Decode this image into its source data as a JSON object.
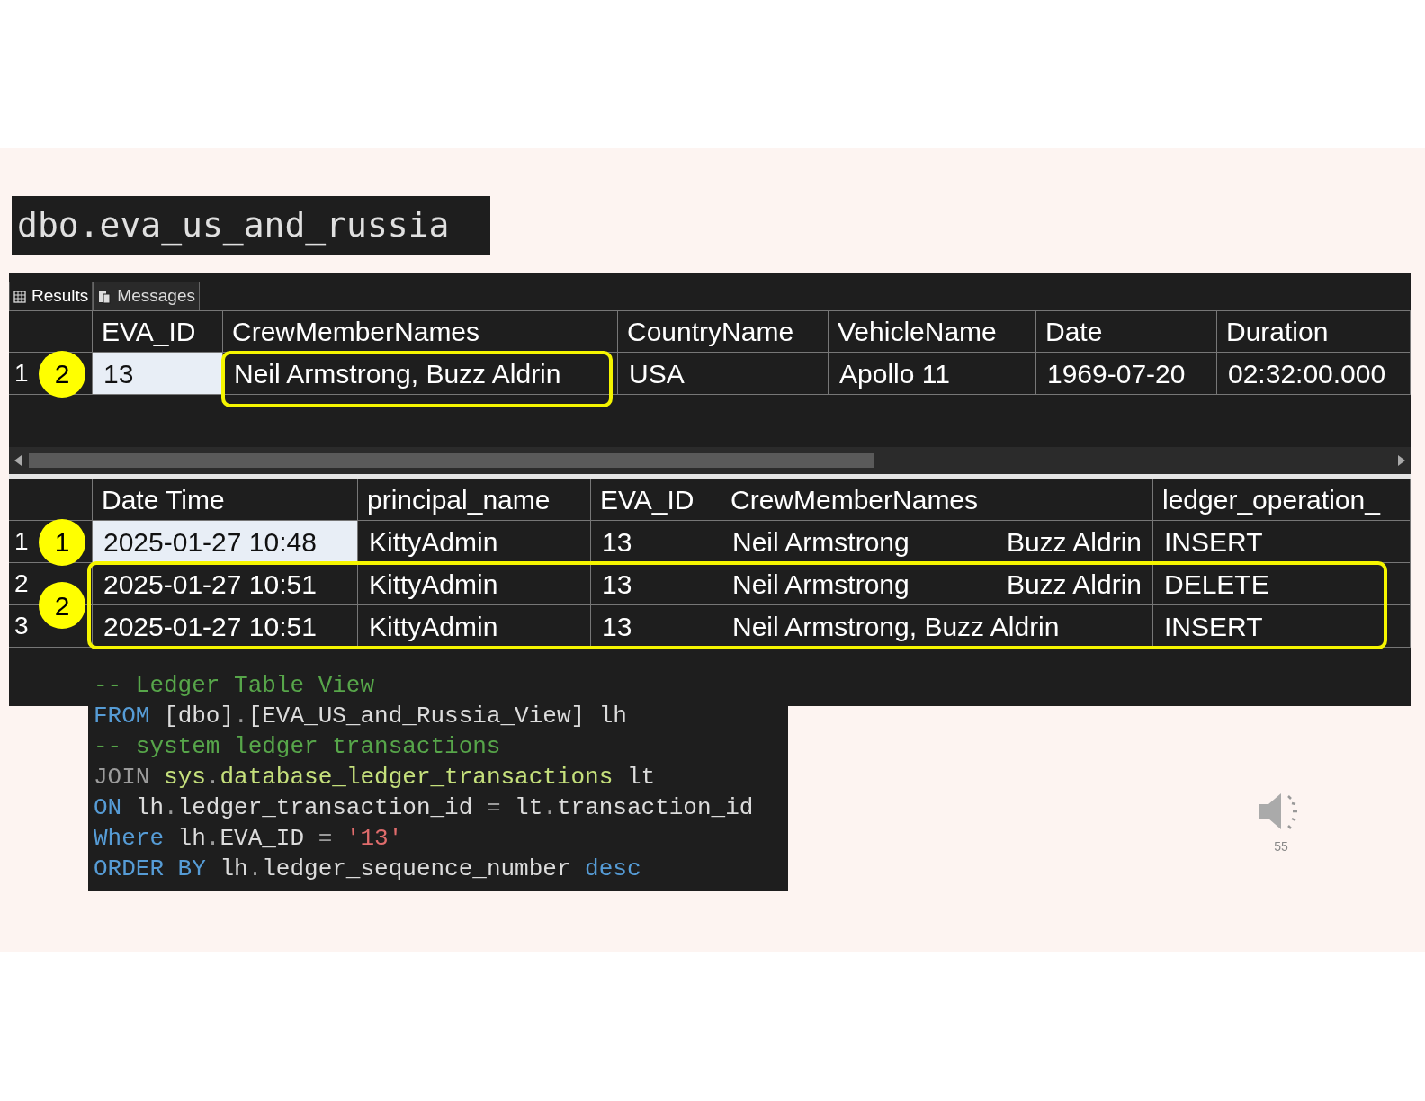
{
  "title": "dbo.eva_us_and_russia",
  "tabs": [
    {
      "label": "Results",
      "selected": true
    },
    {
      "label": "Messages",
      "selected": false
    }
  ],
  "results_table": {
    "columns": [
      "EVA_ID",
      "CrewMemberNames",
      "CountryName",
      "VehicleName",
      "Date",
      "Duration"
    ],
    "row_groups": [
      {
        "badge": "2",
        "outlined": false,
        "rows": [
          {
            "number": "1",
            "cells": [
              {
                "text": [
                  "13"
                ],
                "selected": true,
                "outlined": false
              },
              {
                "text": [
                  "Neil Armstrong, Buzz Aldrin"
                ],
                "selected": false,
                "outlined": true
              },
              {
                "text": [
                  "USA"
                ],
                "selected": false,
                "outlined": false
              },
              {
                "text": [
                  "Apollo 11"
                ],
                "selected": false,
                "outlined": false
              },
              {
                "text": [
                  "1969-07-20"
                ],
                "selected": false,
                "outlined": false
              },
              {
                "text": [
                  "02:32:00.000"
                ],
                "selected": false,
                "outlined": false
              }
            ]
          }
        ]
      }
    ]
  },
  "ledger_table": {
    "columns": [
      "Date Time",
      "principal_name",
      "EVA_ID",
      "CrewMemberNames",
      "ledger_operation_"
    ],
    "row_groups": [
      {
        "badge": "1",
        "outlined": false,
        "rows": [
          {
            "number": "1",
            "cells": [
              {
                "text": [
                  "2025-01-27 10:48"
                ],
                "selected": true,
                "outlined": false
              },
              {
                "text": [
                  "KittyAdmin"
                ],
                "selected": false,
                "outlined": false
              },
              {
                "text": [
                  "13"
                ],
                "selected": false,
                "outlined": false
              },
              {
                "text": [
                  "Neil Armstrong",
                  "Buzz Aldrin"
                ],
                "selected": false,
                "outlined": false
              },
              {
                "text": [
                  "INSERT"
                ],
                "selected": false,
                "outlined": false
              }
            ]
          }
        ]
      },
      {
        "badge": "2",
        "outlined": true,
        "rows": [
          {
            "number": "2",
            "cells": [
              {
                "text": [
                  "2025-01-27 10:51"
                ],
                "selected": false,
                "outlined": false
              },
              {
                "text": [
                  "KittyAdmin"
                ],
                "selected": false,
                "outlined": false
              },
              {
                "text": [
                  "13"
                ],
                "selected": false,
                "outlined": false
              },
              {
                "text": [
                  "Neil Armstrong",
                  "Buzz Aldrin"
                ],
                "selected": false,
                "outlined": false
              },
              {
                "text": [
                  "DELETE"
                ],
                "selected": false,
                "outlined": false
              }
            ]
          },
          {
            "number": "3",
            "cells": [
              {
                "text": [
                  "2025-01-27 10:51"
                ],
                "selected": false,
                "outlined": false
              },
              {
                "text": [
                  "KittyAdmin"
                ],
                "selected": false,
                "outlined": false
              },
              {
                "text": [
                  "13"
                ],
                "selected": false,
                "outlined": false
              },
              {
                "text": [
                  "Neil Armstrong, Buzz Aldrin"
                ],
                "selected": false,
                "outlined": false
              },
              {
                "text": [
                  "INSERT"
                ],
                "selected": false,
                "outlined": false
              }
            ]
          }
        ]
      }
    ]
  },
  "code": [
    [
      {
        "kind": "comment",
        "text": "-- Ledger Table View"
      }
    ],
    [
      {
        "kind": "keyword",
        "text": "FROM"
      },
      {
        "kind": "plain",
        "text": " [dbo]"
      },
      {
        "kind": "op",
        "text": "."
      },
      {
        "kind": "plain",
        "text": "[EVA_US_and_Russia_View] lh"
      }
    ],
    [
      {
        "kind": "comment",
        "text": "-- system ledger transactions"
      }
    ],
    [
      {
        "kind": "op",
        "text": "JOIN"
      },
      {
        "kind": "object",
        "text": " sys"
      },
      {
        "kind": "op",
        "text": "."
      },
      {
        "kind": "object",
        "text": "database_ledger_transactions"
      },
      {
        "kind": "plain",
        "text": " lt"
      }
    ],
    [
      {
        "kind": "keyword",
        "text": "ON"
      },
      {
        "kind": "plain",
        "text": " lh"
      },
      {
        "kind": "op",
        "text": "."
      },
      {
        "kind": "plain",
        "text": "ledger_transaction_id "
      },
      {
        "kind": "op",
        "text": "="
      },
      {
        "kind": "plain",
        "text": " lt"
      },
      {
        "kind": "op",
        "text": "."
      },
      {
        "kind": "plain",
        "text": "transaction_id"
      }
    ],
    [
      {
        "kind": "keyword",
        "text": "Where"
      },
      {
        "kind": "plain",
        "text": " lh"
      },
      {
        "kind": "op",
        "text": "."
      },
      {
        "kind": "plain",
        "text": "EVA_ID "
      },
      {
        "kind": "op",
        "text": "="
      },
      {
        "kind": "string",
        "text": " '13'"
      }
    ],
    [
      {
        "kind": "keyword",
        "text": "ORDER BY"
      },
      {
        "kind": "plain",
        "text": " lh"
      },
      {
        "kind": "op",
        "text": "."
      },
      {
        "kind": "plain",
        "text": "ledger_sequence_number "
      },
      {
        "kind": "keyword",
        "text": "desc"
      }
    ]
  ],
  "slide_number": "55"
}
